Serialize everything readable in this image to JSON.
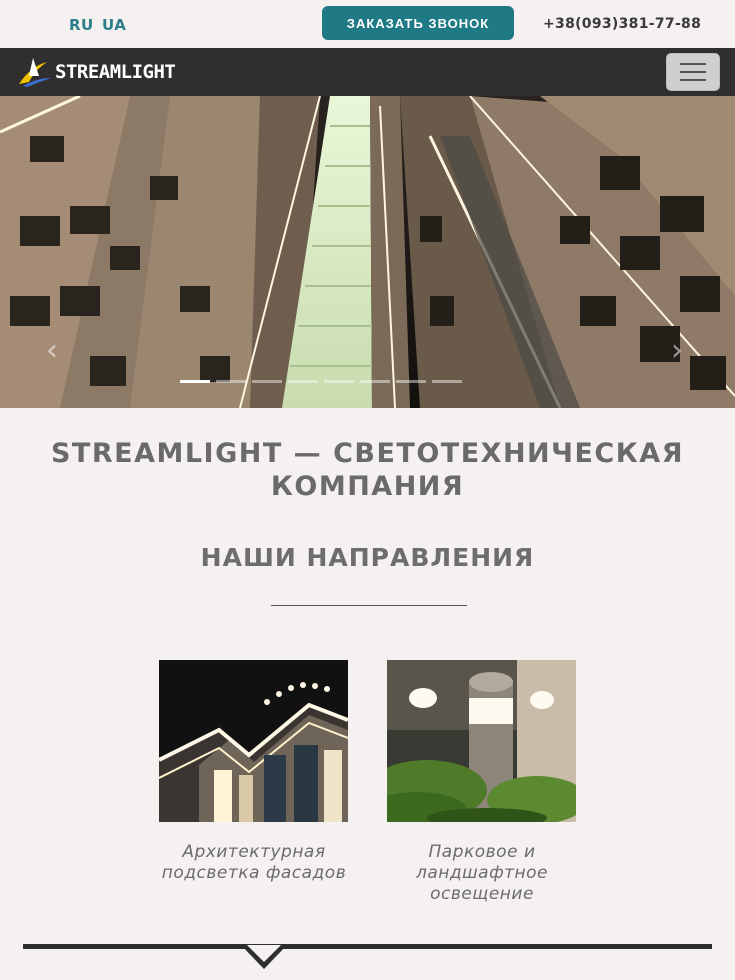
{
  "topbar": {
    "lang_ru": "RU",
    "lang_ua": "UA",
    "call_button": "ЗАКАЗАТЬ ЗВОНОК",
    "phone": "+38(093)381-77-88"
  },
  "navbar": {
    "logo_text": "STREAMLIGHT",
    "menu_icon": "hamburger-icon"
  },
  "carousel": {
    "slides_count": 8,
    "active_index": 0,
    "prev_icon": "chevron-left-icon",
    "next_icon": "chevron-right-icon"
  },
  "main": {
    "title": "STREAMLIGHT — СВЕТОТЕХНИЧЕСКАЯ КОМПАНИЯ",
    "section_title": "НАШИ НАПРАВЛЕНИЯ",
    "directions": [
      {
        "label": "Архитектурная подсветка фасадов"
      },
      {
        "label": "Парковое и ландшафтное освещение"
      }
    ]
  },
  "footer": {
    "scroll_icon": "chevron-down-icon"
  },
  "colors": {
    "accent": "#1f7a86",
    "nav_bg": "#2f2f2f",
    "page_bg": "#f4f1f0"
  }
}
